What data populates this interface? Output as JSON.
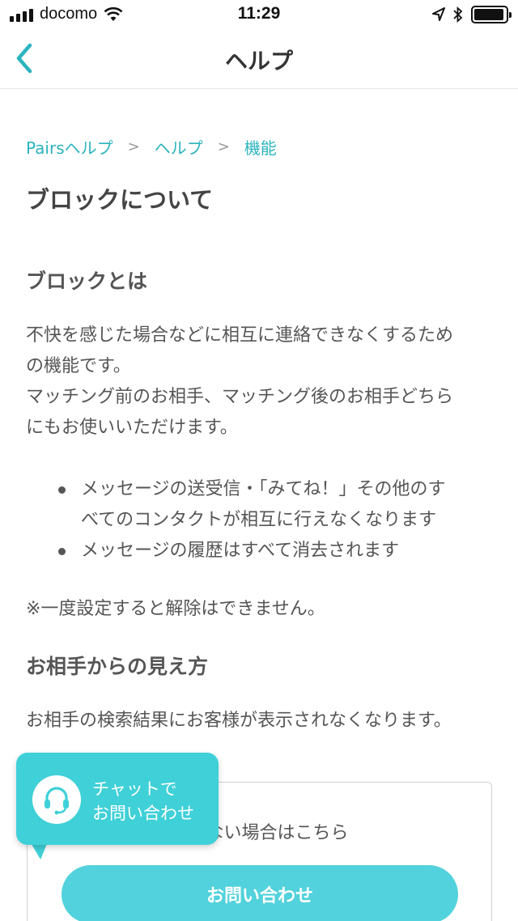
{
  "status_bar": {
    "carrier": "docomo",
    "time": "11:29"
  },
  "nav": {
    "title": "ヘルプ"
  },
  "breadcrumb": {
    "items": [
      "Pairsヘルプ",
      "ヘルプ",
      "機能"
    ],
    "separator": ">"
  },
  "article": {
    "title": "ブロックについて",
    "section1_heading": "ブロックとは",
    "section1_para_lines": [
      "不快を感じた場合などに相互に連絡できなくするため",
      "の機能です。",
      "マッチング前のお相手、マッチング後のお相手どちら",
      "にもお使いいただけます。"
    ],
    "bullets": [
      [
        "メッセージの送受信・「みてね！」その他のす",
        "べてのコンタクトが相互に行えなくなります"
      ],
      [
        "メッセージの履歴はすべて消去されます"
      ]
    ],
    "note": "※一度設定すると解除はできません。",
    "section2_heading": "お相手からの見え方",
    "section2_para": "お相手の検索結果にお客様が表示されなくなります。"
  },
  "contact": {
    "text_visible": "されない場合はこちら",
    "button_label": "お問い合わせ"
  },
  "chat": {
    "label_line1": "チャットで",
    "label_line2": "お問い合わせ"
  },
  "colors": {
    "accent": "#2bb3bf",
    "button": "#52d2dc",
    "chat": "#3fd0d8"
  }
}
